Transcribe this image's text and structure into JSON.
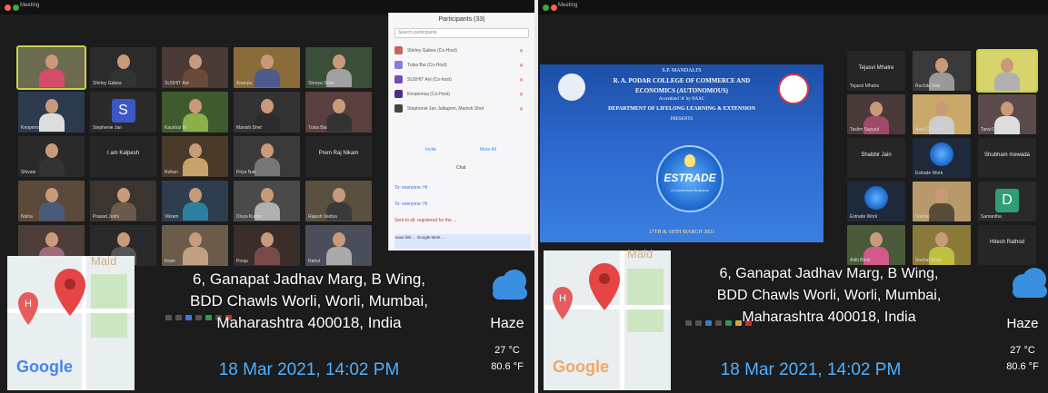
{
  "left": {
    "window_title": "Meeting",
    "panel": {
      "title": "Participants (33)",
      "search_placeholder": "Search participants",
      "participants": [
        {
          "name": "Shirley Gabea (Co-Host)",
          "color": "#c9645a"
        },
        {
          "name": "Tulsa Bai (Co-Host)",
          "color": "#8a7bd8"
        },
        {
          "name": "SUSHIT Ani (Co-host)",
          "color": "#7a4bb5"
        },
        {
          "name": "Keopemsa (Co-Host)",
          "color": "#4a2f8a"
        },
        {
          "name": "Stephenie Jan Jaltagrim, Manish Shet",
          "color": "#444"
        }
      ],
      "invite_label": "Invite",
      "mute_all_label": "Mute All",
      "chat_label": "Chat",
      "chat_lines": [
        "To: everyone: Hi",
        "To: everyone: Hi",
        "Sent to all: registered for the ..."
      ],
      "chat_input": "save link ... Google Meet ..."
    },
    "tiles": [
      {
        "name": "",
        "kind": "face",
        "bg": "#6b6b50",
        "shirt": "#d24e6a",
        "selected": true
      },
      {
        "name": "Shirley Gabea",
        "kind": "face",
        "bg": "#2b2b2b",
        "shirt": "#333"
      },
      {
        "name": "SUSHIT Ani",
        "kind": "face",
        "bg": "#4a3b36",
        "shirt": "#6b4a3a"
      },
      {
        "name": "Ananya",
        "kind": "face",
        "bg": "#8a6c3b",
        "shirt": "#4d5b8a"
      },
      {
        "name": "Shreya Shah",
        "kind": "face",
        "bg": "#3b4e3a",
        "shirt": "#a0a0a0"
      },
      {
        "name": "Keopemsa",
        "kind": "face",
        "bg": "#2d3b4e",
        "shirt": "#ddd"
      },
      {
        "name": "Stephenie Jan",
        "kind": "letter",
        "letter": "S",
        "lbg": "#3c57c7"
      },
      {
        "name": "Kaushal M",
        "kind": "face",
        "bg": "#3f5b2e",
        "shirt": "#8bb04a"
      },
      {
        "name": "Manish Shet",
        "kind": "face",
        "bg": "#333",
        "shirt": "#2c2c2c"
      },
      {
        "name": "Tulsa Bai",
        "kind": "face",
        "bg": "#5a3f3f",
        "shirt": "#333"
      },
      {
        "name": "Shivani",
        "kind": "face",
        "bg": "#2a2a2a",
        "shirt": "#333"
      },
      {
        "name": "",
        "kind": "text",
        "text": "I am Kalpesh"
      },
      {
        "name": "Rohan",
        "kind": "face",
        "bg": "#4a3a2a",
        "shirt": "#c9a26a"
      },
      {
        "name": "Priya Nair",
        "kind": "face",
        "bg": "#3a3a3a",
        "shirt": "#777"
      },
      {
        "name": "",
        "kind": "text",
        "text": "Prem Raj Nikam"
      },
      {
        "name": "Nisha",
        "kind": "face",
        "bg": "#5b4a3a",
        "shirt": "#4a5a7a"
      },
      {
        "name": "Prasad Joshi",
        "kind": "face",
        "bg": "#3a3530",
        "shirt": "#6a5a4a"
      },
      {
        "name": "Vikram",
        "kind": "face",
        "bg": "#2e3e4e",
        "shirt": "#2d7fa0"
      },
      {
        "name": "Divya Kumar",
        "kind": "face",
        "bg": "#4a4a4a",
        "shirt": "#b0b0b0"
      },
      {
        "name": "Rajesh Vaidya",
        "kind": "face",
        "bg": "#5a5040",
        "shirt": "#3a3a3a"
      },
      {
        "name": "Sneha",
        "kind": "face",
        "bg": "#4e3e3a",
        "shirt": "#a06a7a"
      },
      {
        "name": "Amit",
        "kind": "face",
        "bg": "#2a2a2a",
        "shirt": "#555"
      },
      {
        "name": "Kiran",
        "kind": "face",
        "bg": "#6a5b4a",
        "shirt": "#c0a080"
      },
      {
        "name": "Pooja",
        "kind": "face",
        "bg": "#3a2e2a",
        "shirt": "#7a4a4a"
      },
      {
        "name": "Rahul",
        "kind": "face",
        "bg": "#4a4e5a",
        "shirt": "#aaa"
      }
    ],
    "map_word": "Mald",
    "address_lines": [
      "6, Ganapat Jadhav Marg, B Wing,",
      "BDD Chawls Worli, Worli, Mumbai,",
      "Maharashtra 400018, India"
    ],
    "datetime": "18 Mar 2021, 14:02 PM",
    "weather": {
      "condition": "Haze",
      "celsius": "27 °C",
      "fahrenheit": "80.6 °F"
    },
    "google_label": "Google"
  },
  "right": {
    "window_title": "Meeting",
    "slide": {
      "line1": "S.P. MANDALI'S",
      "line2": "R. A. PODAR COLLEGE OF COMMERCE AND",
      "line3": "ECONOMICS (AUTONOMOUS)",
      "line4": "Accredited 'A' by NAAC",
      "line5": "DEPARTMENT OF LIFELONG LEARNING & EXTENSION",
      "line6": "PRESENTS",
      "logo_text": "ESTRADE",
      "logo_sub": "A Conference Business",
      "date_line": "17TH & 18TH MARCH 2021"
    },
    "tiles": [
      {
        "name": "Tejasvi Mhatre",
        "kind": "text",
        "text": "Tejasvi Mhatre"
      },
      {
        "name": "Ruchita Mali",
        "kind": "face",
        "bg": "#3a3a3a",
        "shirt": "#999"
      },
      {
        "name": "",
        "kind": "face",
        "bg": "#d8d36a",
        "shirt": "#b0b0b0",
        "selected": true
      },
      {
        "name": "Taslim Sayyad",
        "kind": "face",
        "bg": "#4a3a3a",
        "shirt": "#a04a6a"
      },
      {
        "name": "Aarti Chauhan",
        "kind": "face",
        "bg": "#c9a86a",
        "shirt": "#ccc"
      },
      {
        "name": "Tanvi Dabholkar",
        "kind": "face",
        "bg": "#5a4a4a",
        "shirt": "#ddd"
      },
      {
        "name": "",
        "kind": "text",
        "text": "Shabbir Jain"
      },
      {
        "name": "Estrade Work",
        "kind": "logo"
      },
      {
        "name": "",
        "kind": "text",
        "text": "Shubham mewada"
      },
      {
        "name": "Estrade Work",
        "kind": "logo"
      },
      {
        "name": "Snehal",
        "kind": "face",
        "bg": "#b89a6a",
        "shirt": "#5a4a3a"
      },
      {
        "name": "Samantha",
        "kind": "letter",
        "letter": "D",
        "lbg": "#2f9e72"
      },
      {
        "name": "Aditi Bhoir",
        "kind": "face",
        "bg": "#4a5a3a",
        "shirt": "#d25a8a"
      },
      {
        "name": "Snehal Shah",
        "kind": "face",
        "bg": "#8a7a3a",
        "shirt": "#c0c040"
      },
      {
        "name": "",
        "kind": "text",
        "text": "Hitesh Rathod"
      }
    ],
    "map_word": "Mald",
    "address_lines": [
      "6, Ganapat Jadhav Marg, B Wing,",
      "BDD Chawls Worli, Worli, Mumbai,",
      "Maharashtra 400018, India"
    ],
    "datetime": "18 Mar 2021, 14:02 PM",
    "weather": {
      "condition": "Haze",
      "celsius": "27 °C",
      "fahrenheit": "80.6 °F"
    },
    "google_label": "Google"
  }
}
